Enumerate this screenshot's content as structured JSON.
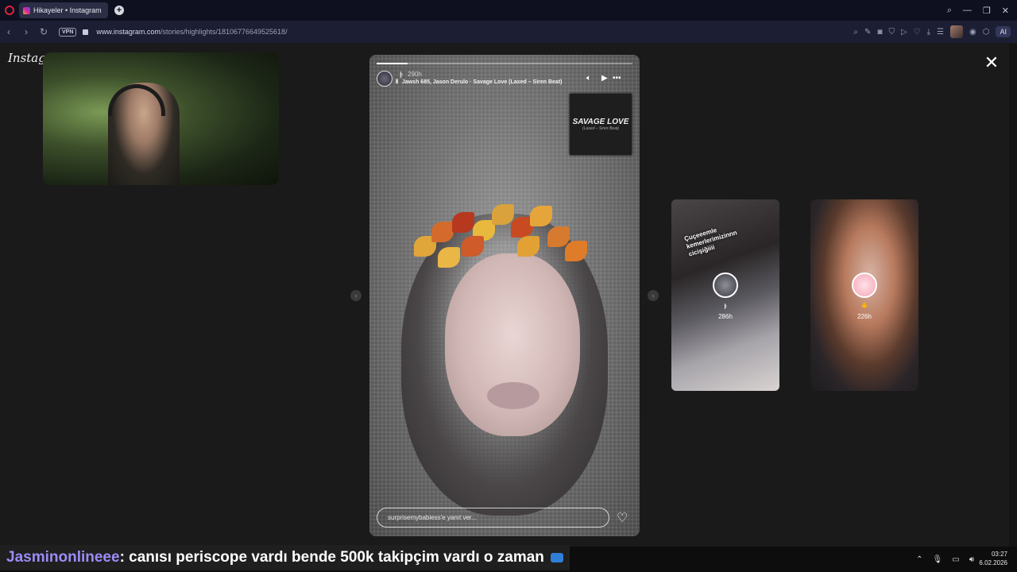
{
  "browser": {
    "tab_title": "Hikayeler • Instagram",
    "new_tab_icon": "+",
    "url_host": "www.instagram.com",
    "url_path": "/stories/highlights/18106776649525618/",
    "vpn_label": "VPN",
    "ai_label": "AI"
  },
  "page": {
    "brand": "Instagram"
  },
  "story": {
    "username": "ㅑ",
    "time": "290h",
    "music": "Jawsh 685, Jason Derulo · Savage Love (Laxed – Siren Beat)",
    "album_title": "SAVAGE LOVE",
    "album_subtitle": "(Laxed – Siren Beat)",
    "reply_placeholder": "surprisemybabiess'e yanıt ver...",
    "progress": 0.12
  },
  "side_stories": [
    {
      "sticker_line1": "Çuçeeemle",
      "sticker_line2": "kemerlerimizinnn",
      "sticker_line3": "cicişiğiiii",
      "user": "ㅑ",
      "time": "286h"
    },
    {
      "user": "🐥",
      "time": "226h"
    }
  ],
  "chat": {
    "username": "Jasminonlineee",
    "message": " : canısı periscope vardı bende 500k takipçim vardı o zaman"
  },
  "clock": {
    "time": "03:27",
    "date": "6.02.2026"
  },
  "colors": {
    "chat_username": "#9b8cf8",
    "opera_red": "#e0223b",
    "tab_bg": "#2b2e45"
  }
}
